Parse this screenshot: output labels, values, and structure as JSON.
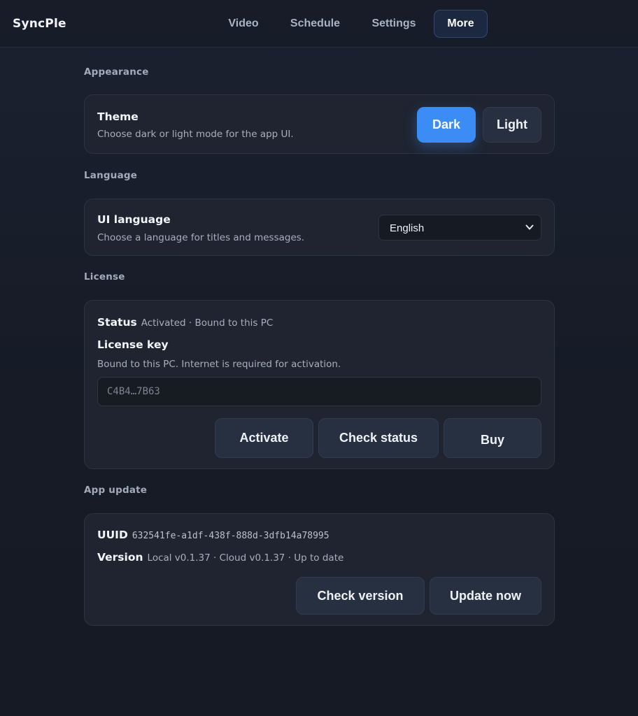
{
  "app": {
    "brand": "SyncPle"
  },
  "nav": {
    "tabs": [
      {
        "label": "Video",
        "active": false
      },
      {
        "label": "Schedule",
        "active": false
      },
      {
        "label": "Settings",
        "active": false
      },
      {
        "label": "More",
        "active": true
      }
    ]
  },
  "appearance": {
    "section_title": "Appearance",
    "theme": {
      "title": "Theme",
      "description": "Choose dark or light mode for the app UI.",
      "dark_label": "Dark",
      "light_label": "Light",
      "selected": "Dark"
    }
  },
  "language": {
    "section_title": "Language",
    "ui_language": {
      "title": "UI language",
      "description": "Choose a language for titles and messages.",
      "selected": "English"
    }
  },
  "license": {
    "section_title": "License",
    "status_label": "Status",
    "status_value": "Activated · Bound to this PC",
    "key_title": "License key",
    "key_description": "Bound to this PC. Internet is required for activation.",
    "key_value": "C4B4…7B63",
    "buttons": {
      "activate": "Activate",
      "check_status": "Check status",
      "buy": "Buy"
    }
  },
  "update": {
    "section_title": "App update",
    "uuid_label": "UUID",
    "uuid_value": "632541fe-a1df-438f-888d-3dfb14a78995",
    "version_label": "Version",
    "version_value": "Local v0.1.37 · Cloud v0.1.37 · Up to date",
    "buttons": {
      "check_version": "Check version",
      "update_now": "Update now"
    }
  },
  "colors": {
    "accent": "#3b8cf5",
    "card_bg": "#1f2430",
    "page_bg": "#181d28"
  }
}
